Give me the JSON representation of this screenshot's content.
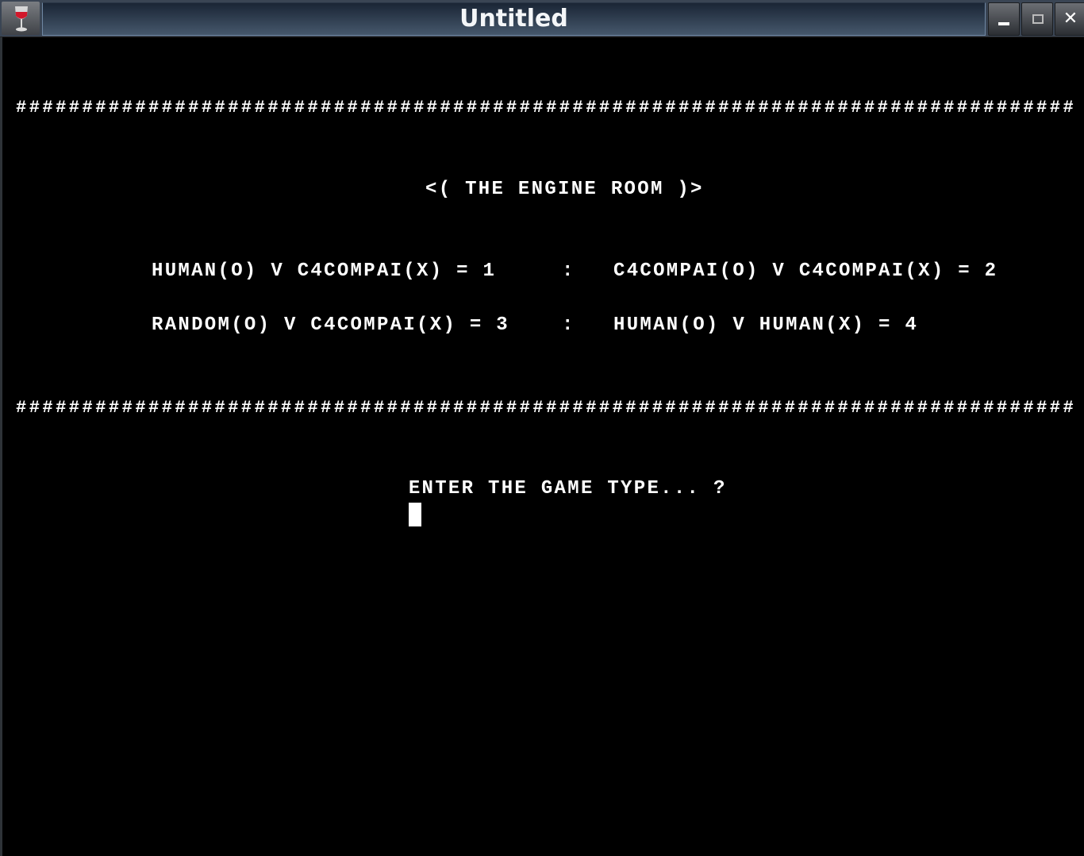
{
  "window": {
    "title": "Untitled",
    "app_icon": "wine-glass-icon",
    "controls": {
      "minimize": "minimize-icon",
      "maximize": "maximize-icon",
      "close": "close-icon",
      "close_glyph": "✕"
    }
  },
  "terminal": {
    "divider": "################################################################################",
    "heading": "<( THE ENGINE ROOM )>",
    "options": [
      {
        "label": "HUMAN(O) V C4COMPAI(X) = 1",
        "value": "1"
      },
      {
        "label": "C4COMPAI(O) V C4COMPAI(X) = 2",
        "value": "2"
      },
      {
        "label": "RANDOM(O) V C4COMPAI(X) = 3",
        "value": "3"
      },
      {
        "label": "HUMAN(O) V HUMAN(X) = 4",
        "value": "4"
      }
    ],
    "separator": ":",
    "prompt": "ENTER THE GAME TYPE... ?",
    "input_value": ""
  },
  "colors": {
    "background": "#000000",
    "text": "#ffffff",
    "titlebar": "#3a4554"
  }
}
